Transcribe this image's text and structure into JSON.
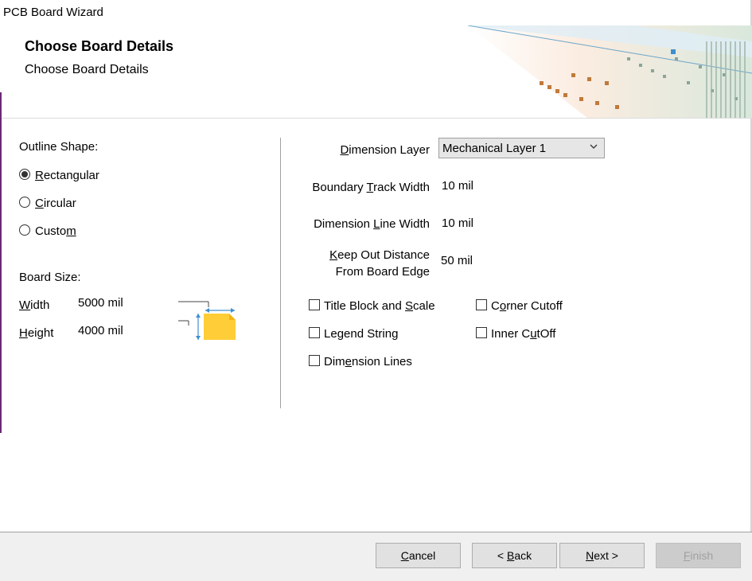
{
  "window": {
    "title": "PCB Board Wizard"
  },
  "header": {
    "title": "Choose Board Details",
    "subtitle": "Choose Board Details"
  },
  "outline": {
    "label": "Outline Shape:",
    "options": [
      {
        "pre": "",
        "key": "R",
        "post": "ectangular",
        "selected": true
      },
      {
        "pre": "",
        "key": "C",
        "post": "ircular",
        "selected": false
      },
      {
        "pre": "Custo",
        "key": "m",
        "post": "",
        "selected": false
      }
    ]
  },
  "board_size": {
    "label": "Board Size:",
    "width": {
      "key": "W",
      "label": "idth",
      "value": "5000 mil"
    },
    "height": {
      "key": "H",
      "label": "eight",
      "value": "4000 mil"
    }
  },
  "params": {
    "dimension_layer": {
      "key": "D",
      "label": "imension Layer",
      "value": "Mechanical Layer 1"
    },
    "boundary_track": {
      "pre": "Boundary ",
      "key": "T",
      "post": "rack Width",
      "value": "10 mil"
    },
    "dimension_line": {
      "pre": "Dimension ",
      "key": "L",
      "post": "ine Width",
      "value": "10 mil"
    },
    "keep_out": {
      "key": "K",
      "line1": "eep Out Distance",
      "line2": "From Board Edge",
      "value": "50 mil"
    }
  },
  "checkboxes": {
    "title_block": {
      "pre": "Title Block and ",
      "key": "S",
      "post": "cale",
      "checked": false
    },
    "legend": {
      "pre": "Le",
      "key": "g",
      "post": "end String",
      "checked": false
    },
    "dim_lines": {
      "pre": "Dim",
      "key": "e",
      "post": "nsion Lines",
      "checked": false
    },
    "corner": {
      "pre": "C",
      "key": "o",
      "post": "rner Cutoff",
      "checked": false
    },
    "inner": {
      "pre": "Inner C",
      "key": "u",
      "post": "tOff",
      "checked": false
    }
  },
  "buttons": {
    "cancel": {
      "key": "C",
      "post": "ancel"
    },
    "back": {
      "pre": "< ",
      "key": "B",
      "post": "ack"
    },
    "next": {
      "key": "N",
      "post": "ext >"
    },
    "finish": {
      "key": "F",
      "post": "inish"
    }
  },
  "colors": {
    "accent": "#6d2877",
    "board_fill": "#fecd37",
    "dimension_arrows": "#3d8fd1"
  }
}
